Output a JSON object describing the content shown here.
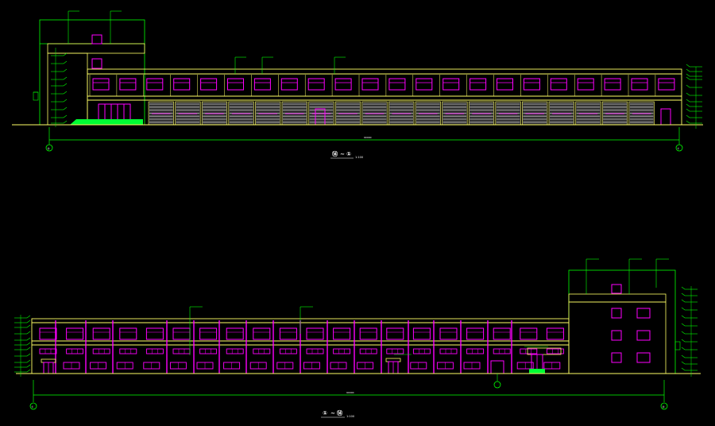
{
  "drawing": {
    "colors": {
      "background": "#000000",
      "outline": "#ffff66",
      "window": "#ff00ff",
      "annotation": "#00ff00",
      "door_fill": "#00ff33",
      "shutter": "#bbbbbb",
      "text": "#ffffff"
    },
    "elevation_top": {
      "title_left": "⑭",
      "title_sep": "~",
      "title_right": "①",
      "scale": "1:100",
      "axis_left": "⑭",
      "axis_right": "①",
      "overall_dim": "90000",
      "upper_window_count": 22,
      "shutter_count": 19
    },
    "elevation_bottom": {
      "title_left": "①",
      "title_sep": "~",
      "title_right": "⑭",
      "scale": "1:100",
      "axis_left": "①",
      "axis_right": "⑭",
      "overall_dim": "90000",
      "upper_window_count": 20,
      "lower_window_count": 20
    }
  }
}
